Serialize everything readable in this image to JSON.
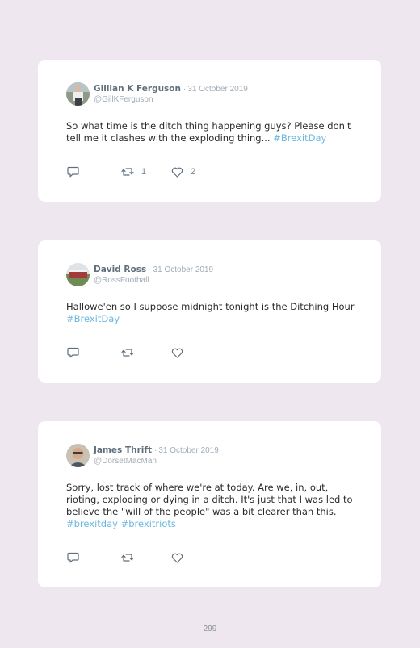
{
  "tweets": [
    {
      "author": "Gillian K Ferguson",
      "separator": "·",
      "date": "31 October 2019",
      "handle": "@GillKFerguson",
      "text": "So what time is the ditch thing happening guys? Please don't tell me it clashes with the exploding thing... ",
      "hashtags": "#BrexitDay",
      "retweets": "1",
      "likes": "2"
    },
    {
      "author": "David Ross",
      "separator": "·",
      "date": "31 October 2019",
      "handle": "@RossFootball",
      "text": "Hallowe'en so I suppose midnight tonight is the Ditching Hour ",
      "hashtags": "#BrexitDay",
      "retweets": "",
      "likes": ""
    },
    {
      "author": "James Thrift",
      "separator": "·",
      "date": "31 October 2019",
      "handle": "@DorsetMacMan",
      "text": "Sorry, lost track of where we're at today. Are we, in, out, rioting, exploding or dying in a ditch. It's just that I was led to believe the \"will of the people\" was a bit clearer than this. ",
      "hashtags": "#brexitday #brexitriots",
      "retweets": "",
      "likes": ""
    }
  ],
  "page_number": "299",
  "icons": {
    "reply": "reply-icon",
    "retweet": "retweet-icon",
    "like": "heart-icon"
  },
  "colors": {
    "background": "#efe7ef",
    "card": "#ffffff",
    "hashtag": "#6ab7de",
    "author": "#5f6f7c",
    "meta": "#a3adb5"
  }
}
